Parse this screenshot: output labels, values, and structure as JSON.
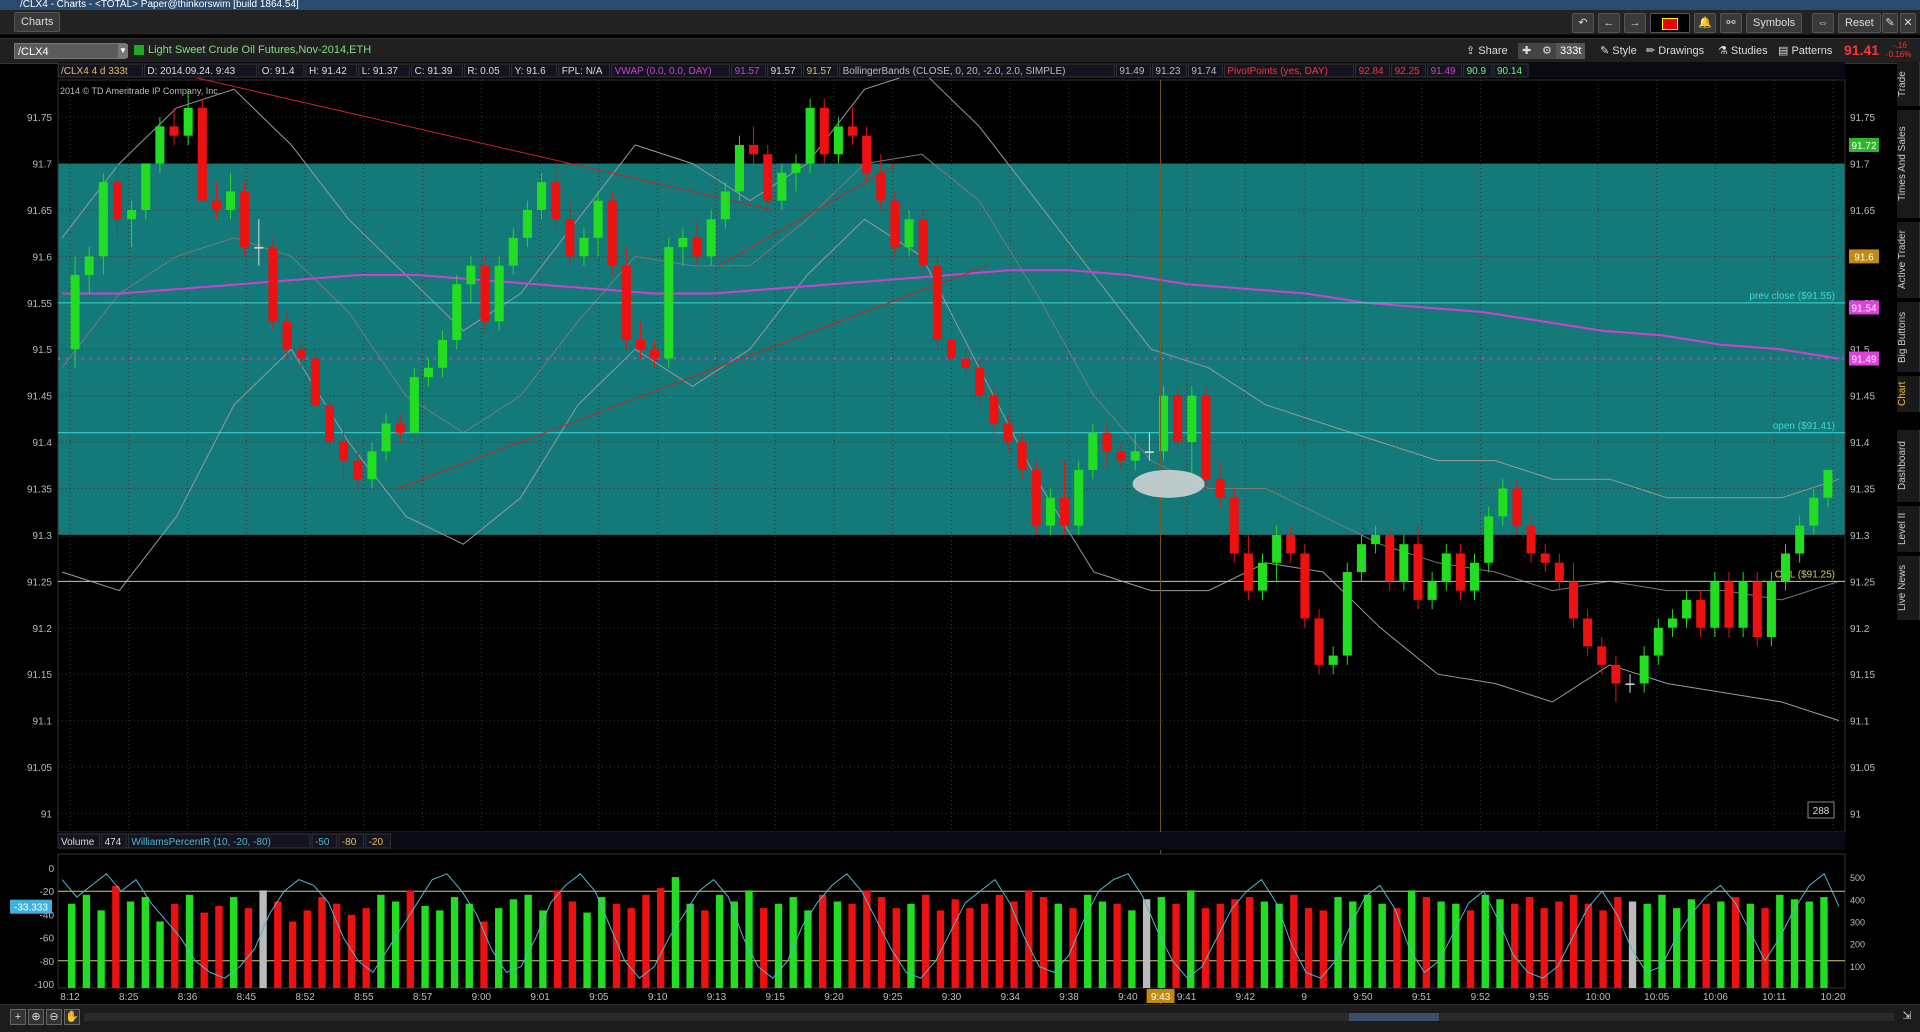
{
  "window": {
    "title": "/CLX4 - Charts - <TOTAL> Paper@thinkorswim [build 1864.54]"
  },
  "toolbar": {
    "charts_tab": "Charts",
    "symbols": "Symbols",
    "reset": "Reset"
  },
  "chart_header": {
    "symbol": "/CLX4",
    "description": "Light Sweet Crude Oil Futures,Nov-2014,ETH",
    "share": "Share",
    "aggregation": "333t",
    "style": "Style",
    "drawings": "Drawings",
    "studies": "Studies",
    "patterns": "Patterns",
    "last_price": "91.41",
    "change_top": "-.16",
    "change_bottom": "-0.16%"
  },
  "status_line": {
    "settings": "/CLX4 4 d 333t",
    "date": "D: 2014.09.24. 9:43",
    "open": "O: 91.4",
    "high": "H: 91.42",
    "low": "L: 91.37",
    "close": "C: 91.39",
    "range": "R: 0.05",
    "y": "Y: 91.6",
    "fpl": "FPL: N/A",
    "vwap": "VWAP (0.0, 0.0, DAY)",
    "vwap_v1": "91.57",
    "vwap_v2": "91.57",
    "vwap_v3": "91.57",
    "bb": "BollingerBands (CLOSE, 0, 20, -2.0, 2.0, SIMPLE)",
    "bb_v1": "91.49",
    "bb_v2": "91.23",
    "bb_v3": "91.74",
    "pivots": "PivotPoints (yes, DAY)",
    "pp_v1": "92.84",
    "pp_v2": "92.25",
    "pp_v3": "91.49",
    "pp_v4": "90.9",
    "pp_v5": "90.14",
    "copyright": "2014 © TD Ameritrade IP Company, Inc."
  },
  "lower_panel": {
    "volume": "Volume",
    "volume_value": "474",
    "wpr": "WilliamsPercentR (10, -20, -80)",
    "wpr_v1": "-50",
    "wpr_v2": "-80",
    "wpr_v3": "-20",
    "wpr_current": "-33.333"
  },
  "chart_data": {
    "type": "candlestick",
    "y_ticks": [
      "91.75",
      "91.7",
      "91.65",
      "91.6",
      "91.55",
      "91.5",
      "91.45",
      "91.4",
      "91.35",
      "91.3",
      "91.25",
      "91.2",
      "91.15",
      "91.1",
      "91.05",
      "91"
    ],
    "ylim": [
      90.98,
      91.79
    ],
    "x_ticks": [
      "8:12",
      "8:25",
      "8:36",
      "8:45",
      "8:52",
      "8:55",
      "8:57",
      "9:00",
      "9:01",
      "9:05",
      "9:10",
      "9:13",
      "9:15",
      "9:20",
      "9:25",
      "9:30",
      "9:34",
      "9:38",
      "9:40",
      "9:41",
      "9:42",
      "9",
      "9:50",
      "9:51",
      "9:52",
      "9:55",
      "10:00",
      "10:05",
      "10:06",
      "10:11",
      "10:20"
    ],
    "cursor_time": "9:43",
    "bar_count_label": "288",
    "right_labels": [
      {
        "text": "91.72",
        "value": 91.72,
        "color": "#2db52d"
      },
      {
        "text": "91.6",
        "value": 91.6,
        "color": "#c08a10"
      },
      {
        "text": "91.54",
        "value": 91.545,
        "color": "#e040e0"
      },
      {
        "text": "91.49",
        "value": 91.49,
        "color": "#e040e0"
      }
    ],
    "levels": [
      {
        "label": "prev close ($91.55)",
        "value": 91.55,
        "color": "#3fd8d8"
      },
      {
        "label": "open ($91.41)",
        "value": 91.41,
        "color": "#3fd8d8"
      },
      {
        "label": "ONL ($91.25)",
        "value": 91.25,
        "color": "#d8c86a"
      }
    ],
    "pivot_dotted": 91.49,
    "shaded_zone": [
      91.3,
      91.7
    ],
    "candles": [
      [
        91.5,
        91.6,
        91.48,
        91.58
      ],
      [
        91.58,
        91.61,
        91.56,
        91.6
      ],
      [
        91.6,
        91.69,
        91.58,
        91.68
      ],
      [
        91.68,
        91.7,
        91.62,
        91.64
      ],
      [
        91.64,
        91.66,
        91.61,
        91.65
      ],
      [
        91.65,
        91.7,
        91.64,
        91.7
      ],
      [
        91.7,
        91.75,
        91.69,
        91.74
      ],
      [
        91.74,
        91.76,
        91.72,
        91.73
      ],
      [
        91.73,
        91.78,
        91.72,
        91.76
      ],
      [
        91.76,
        91.77,
        91.68,
        91.66
      ],
      [
        91.66,
        91.68,
        91.64,
        91.65
      ],
      [
        91.65,
        91.69,
        91.64,
        91.67
      ],
      [
        91.67,
        91.68,
        91.6,
        91.61
      ],
      [
        91.61,
        91.64,
        91.59,
        91.61
      ],
      [
        91.61,
        91.62,
        91.52,
        91.53
      ],
      [
        91.53,
        91.54,
        91.49,
        91.5
      ],
      [
        91.5,
        91.51,
        91.48,
        91.49
      ],
      [
        91.49,
        91.5,
        91.44,
        91.44
      ],
      [
        91.44,
        91.45,
        91.39,
        91.4
      ],
      [
        91.4,
        91.42,
        91.36,
        91.38
      ],
      [
        91.38,
        91.39,
        91.35,
        91.36
      ],
      [
        91.36,
        91.4,
        91.35,
        91.39
      ],
      [
        91.39,
        91.43,
        91.38,
        91.42
      ],
      [
        91.42,
        91.43,
        91.4,
        91.41
      ],
      [
        91.41,
        91.48,
        91.41,
        91.47
      ],
      [
        91.47,
        91.49,
        91.46,
        91.48
      ],
      [
        91.48,
        91.52,
        91.47,
        91.51
      ],
      [
        91.51,
        91.58,
        91.5,
        91.57
      ],
      [
        91.57,
        91.6,
        91.55,
        91.59
      ],
      [
        91.59,
        91.6,
        91.52,
        91.53
      ],
      [
        91.53,
        91.6,
        91.52,
        91.59
      ],
      [
        91.59,
        91.63,
        91.58,
        91.62
      ],
      [
        91.62,
        91.66,
        91.61,
        91.65
      ],
      [
        91.65,
        91.69,
        91.64,
        91.68
      ],
      [
        91.68,
        91.7,
        91.63,
        91.64
      ],
      [
        91.64,
        91.66,
        91.59,
        91.6
      ],
      [
        91.6,
        91.63,
        91.59,
        91.62
      ],
      [
        91.62,
        91.67,
        91.6,
        91.66
      ],
      [
        91.66,
        91.67,
        91.58,
        91.59
      ],
      [
        91.59,
        91.61,
        91.5,
        91.51
      ],
      [
        91.51,
        91.53,
        91.49,
        91.5
      ],
      [
        91.5,
        91.51,
        91.48,
        91.49
      ],
      [
        91.49,
        91.62,
        91.48,
        91.61
      ],
      [
        91.61,
        91.63,
        91.59,
        91.62
      ],
      [
        91.62,
        91.64,
        91.59,
        91.6
      ],
      [
        91.6,
        91.65,
        91.59,
        91.64
      ],
      [
        91.64,
        91.68,
        91.63,
        91.67
      ],
      [
        91.67,
        91.73,
        91.66,
        91.72
      ],
      [
        91.72,
        91.74,
        91.7,
        91.71
      ],
      [
        91.71,
        91.72,
        91.65,
        91.66
      ],
      [
        91.66,
        91.7,
        91.65,
        91.69
      ],
      [
        91.69,
        91.71,
        91.67,
        91.7
      ],
      [
        91.7,
        91.77,
        91.69,
        91.76
      ],
      [
        91.76,
        91.77,
        91.7,
        91.71
      ],
      [
        91.71,
        91.75,
        91.7,
        91.74
      ],
      [
        91.74,
        91.76,
        91.72,
        91.73
      ],
      [
        91.73,
        91.74,
        91.68,
        91.69
      ],
      [
        91.69,
        91.71,
        91.65,
        91.66
      ],
      [
        91.66,
        91.67,
        91.6,
        91.61
      ],
      [
        91.61,
        91.65,
        91.6,
        91.64
      ],
      [
        91.64,
        91.65,
        91.58,
        91.59
      ],
      [
        91.59,
        91.6,
        91.5,
        91.51
      ],
      [
        91.51,
        91.52,
        91.48,
        91.49
      ],
      [
        91.49,
        91.5,
        91.47,
        91.48
      ],
      [
        91.48,
        91.49,
        91.44,
        91.45
      ],
      [
        91.45,
        91.46,
        91.41,
        91.42
      ],
      [
        91.42,
        91.43,
        91.39,
        91.4
      ],
      [
        91.4,
        91.41,
        91.36,
        91.37
      ],
      [
        91.37,
        91.38,
        91.3,
        91.31
      ],
      [
        91.31,
        91.35,
        91.3,
        91.34
      ],
      [
        91.34,
        91.38,
        91.3,
        91.31
      ],
      [
        91.31,
        91.38,
        91.3,
        91.37
      ],
      [
        91.37,
        91.42,
        91.36,
        91.41
      ],
      [
        91.41,
        91.42,
        91.37,
        91.39
      ],
      [
        91.39,
        91.4,
        91.37,
        91.38
      ],
      [
        91.38,
        91.41,
        91.37,
        91.39
      ],
      [
        91.39,
        91.41,
        91.38,
        91.39
      ],
      [
        91.39,
        91.46,
        91.38,
        91.45
      ],
      [
        91.45,
        91.46,
        91.39,
        91.4
      ],
      [
        91.4,
        91.46,
        91.36,
        91.45
      ],
      [
        91.45,
        91.46,
        91.35,
        91.36
      ],
      [
        91.36,
        91.38,
        91.33,
        91.34
      ],
      [
        91.34,
        91.35,
        91.27,
        91.28
      ],
      [
        91.28,
        91.3,
        91.23,
        91.24
      ],
      [
        91.24,
        91.28,
        91.23,
        91.27
      ],
      [
        91.27,
        91.31,
        91.25,
        91.3
      ],
      [
        91.3,
        91.31,
        91.27,
        91.28
      ],
      [
        91.28,
        91.29,
        91.2,
        91.21
      ],
      [
        91.21,
        91.22,
        91.15,
        91.16
      ],
      [
        91.16,
        91.18,
        91.15,
        91.17
      ],
      [
        91.17,
        91.27,
        91.16,
        91.26
      ],
      [
        91.26,
        91.3,
        91.25,
        91.29
      ],
      [
        91.29,
        91.31,
        91.28,
        91.3
      ],
      [
        91.3,
        91.31,
        91.24,
        91.25
      ],
      [
        91.25,
        91.3,
        91.24,
        91.29
      ],
      [
        91.29,
        91.31,
        91.22,
        91.23
      ],
      [
        91.23,
        91.26,
        91.22,
        91.25
      ],
      [
        91.25,
        91.29,
        91.24,
        91.28
      ],
      [
        91.28,
        91.29,
        91.23,
        91.24
      ],
      [
        91.24,
        91.28,
        91.23,
        91.27
      ],
      [
        91.27,
        91.33,
        91.26,
        91.32
      ],
      [
        91.32,
        91.36,
        91.31,
        91.35
      ],
      [
        91.35,
        91.36,
        91.3,
        91.31
      ],
      [
        91.31,
        91.32,
        91.27,
        91.28
      ],
      [
        91.28,
        91.29,
        91.26,
        91.27
      ],
      [
        91.27,
        91.28,
        91.24,
        91.25
      ],
      [
        91.25,
        91.27,
        91.2,
        91.21
      ],
      [
        91.21,
        91.22,
        91.17,
        91.18
      ],
      [
        91.18,
        91.19,
        91.15,
        91.16
      ],
      [
        91.16,
        91.17,
        91.12,
        91.14
      ],
      [
        91.14,
        91.15,
        91.13,
        91.14
      ],
      [
        91.14,
        91.18,
        91.13,
        91.17
      ],
      [
        91.17,
        91.21,
        91.16,
        91.2
      ],
      [
        91.2,
        91.22,
        91.19,
        91.21
      ],
      [
        91.21,
        91.24,
        91.2,
        91.23
      ],
      [
        91.23,
        91.24,
        91.19,
        91.2
      ],
      [
        91.2,
        91.26,
        91.19,
        91.25
      ],
      [
        91.25,
        91.26,
        91.19,
        91.2
      ],
      [
        91.2,
        91.26,
        91.19,
        91.25
      ],
      [
        91.25,
        91.26,
        91.18,
        91.19
      ],
      [
        91.19,
        91.26,
        91.18,
        91.25
      ],
      [
        91.25,
        91.29,
        91.24,
        91.28
      ],
      [
        91.28,
        91.32,
        91.27,
        91.31
      ],
      [
        91.31,
        91.35,
        91.3,
        91.34
      ],
      [
        91.34,
        91.37,
        91.33,
        91.37
      ]
    ],
    "vwap_line": [
      91.56,
      91.56,
      91.565,
      91.57,
      91.575,
      91.58,
      91.58,
      91.575,
      91.57,
      91.565,
      91.56,
      91.56,
      91.565,
      91.57,
      91.575,
      91.58,
      91.585,
      91.585,
      91.58,
      91.57,
      91.565,
      91.56,
      91.55,
      91.545,
      91.54,
      91.53,
      91.52,
      91.515,
      91.505,
      91.5,
      91.49
    ],
    "bb_upper": [
      91.62,
      91.7,
      91.76,
      91.78,
      91.72,
      91.64,
      91.58,
      91.52,
      91.56,
      91.64,
      91.72,
      91.7,
      91.66,
      91.7,
      91.78,
      91.8,
      91.74,
      91.66,
      91.58,
      91.5,
      91.48,
      91.44,
      91.42,
      91.4,
      91.38,
      91.38,
      91.36,
      91.36,
      91.34,
      91.34,
      91.34,
      91.36
    ],
    "bb_lower": [
      91.26,
      91.24,
      91.32,
      91.44,
      91.5,
      91.4,
      91.32,
      91.29,
      91.34,
      91.44,
      91.5,
      91.46,
      91.5,
      91.58,
      91.64,
      91.6,
      91.48,
      91.36,
      91.26,
      91.24,
      91.24,
      91.27,
      91.26,
      91.2,
      91.15,
      91.14,
      91.12,
      91.16,
      91.14,
      91.13,
      91.12,
      91.1
    ],
    "bb_mid": [
      91.48,
      91.56,
      91.6,
      91.62,
      91.6,
      91.54,
      91.45,
      91.41,
      91.45,
      91.53,
      91.6,
      91.59,
      91.59,
      91.64,
      91.7,
      91.71,
      91.66,
      91.56,
      91.45,
      91.38,
      91.35,
      91.35,
      91.32,
      91.29,
      91.27,
      91.26,
      91.24,
      91.25,
      91.24,
      91.24,
      91.23,
      91.25
    ],
    "trend_lines": [
      {
        "from": [
          0.06,
          91.8
        ],
        "to": [
          0.4,
          91.65
        ],
        "color": "#cc2222"
      },
      {
        "from": [
          0.19,
          91.35
        ],
        "to": [
          0.52,
          91.59
        ],
        "color": "#cc2222"
      },
      {
        "from": [
          0.37,
          91.59
        ],
        "to": [
          0.47,
          91.7
        ],
        "color": "#cc2222"
      }
    ],
    "volume": [
      380,
      420,
      350,
      460,
      390,
      410,
      300,
      380,
      420,
      340,
      370,
      410,
      360,
      440,
      390,
      300,
      350,
      410,
      380,
      330,
      360,
      420,
      390,
      440,
      370,
      350,
      410,
      380,
      300,
      360,
      400,
      420,
      350,
      440,
      390,
      340,
      410,
      380,
      360,
      420,
      450,
      500,
      380,
      350,
      420,
      390,
      440,
      360,
      380,
      410,
      350,
      420,
      390,
      380,
      440,
      410,
      360,
      380,
      420,
      350,
      400,
      360,
      380,
      420,
      390,
      440,
      410,
      380,
      360,
      420,
      390,
      380,
      350,
      400,
      410,
      380,
      440,
      360,
      380,
      400,
      410,
      390,
      380,
      420,
      360,
      350,
      410,
      390,
      420,
      380,
      360,
      440,
      410,
      390,
      380,
      350,
      420,
      400,
      380,
      410,
      360,
      390,
      420,
      380,
      350,
      410,
      390,
      380,
      420,
      360,
      400,
      380,
      390,
      410,
      380,
      360,
      420,
      400,
      390,
      410
    ],
    "wpr": [
      -10,
      -25,
      -15,
      -5,
      -20,
      -10,
      -30,
      -45,
      -60,
      -80,
      -90,
      -95,
      -85,
      -70,
      -40,
      -20,
      -10,
      -15,
      -30,
      -60,
      -80,
      -90,
      -70,
      -50,
      -30,
      -10,
      -5,
      -20,
      -40,
      -70,
      -90,
      -85,
      -60,
      -30,
      -15,
      -5,
      -20,
      -50,
      -80,
      -95,
      -85,
      -60,
      -40,
      -20,
      -10,
      -25,
      -60,
      -85,
      -95,
      -80,
      -50,
      -30,
      -15,
      -5,
      -20,
      -45,
      -70,
      -90,
      -95,
      -80,
      -55,
      -30,
      -20,
      -10,
      -30,
      -60,
      -85,
      -90,
      -75,
      -45,
      -20,
      -10,
      -5,
      -25,
      -55,
      -80,
      -95,
      -85,
      -60,
      -35,
      -20,
      -10,
      -30,
      -65,
      -90,
      -95,
      -80,
      -50,
      -25,
      -15,
      -35,
      -70,
      -90,
      -80,
      -55,
      -30,
      -20,
      -45,
      -75,
      -90,
      -95,
      -85,
      -60,
      -35,
      -20,
      -40,
      -70,
      -90,
      -85,
      -60,
      -40,
      -25,
      -15,
      -30,
      -55,
      -80,
      -60,
      -35,
      -15,
      -5,
      -33
    ]
  },
  "colors": {
    "up": "#22dd22",
    "down": "#ee1111",
    "teal_zone": "#147979",
    "vwap": "#d040d0",
    "level": "#3fd8d8",
    "onl": "#c8b050",
    "wpr": "#4fb8d0"
  },
  "side_tabs": [
    "Trade",
    "Times And Sales",
    "Active Trader",
    "Big Buttons",
    "Chart",
    "Dashboard",
    "Level II",
    "Live News"
  ]
}
